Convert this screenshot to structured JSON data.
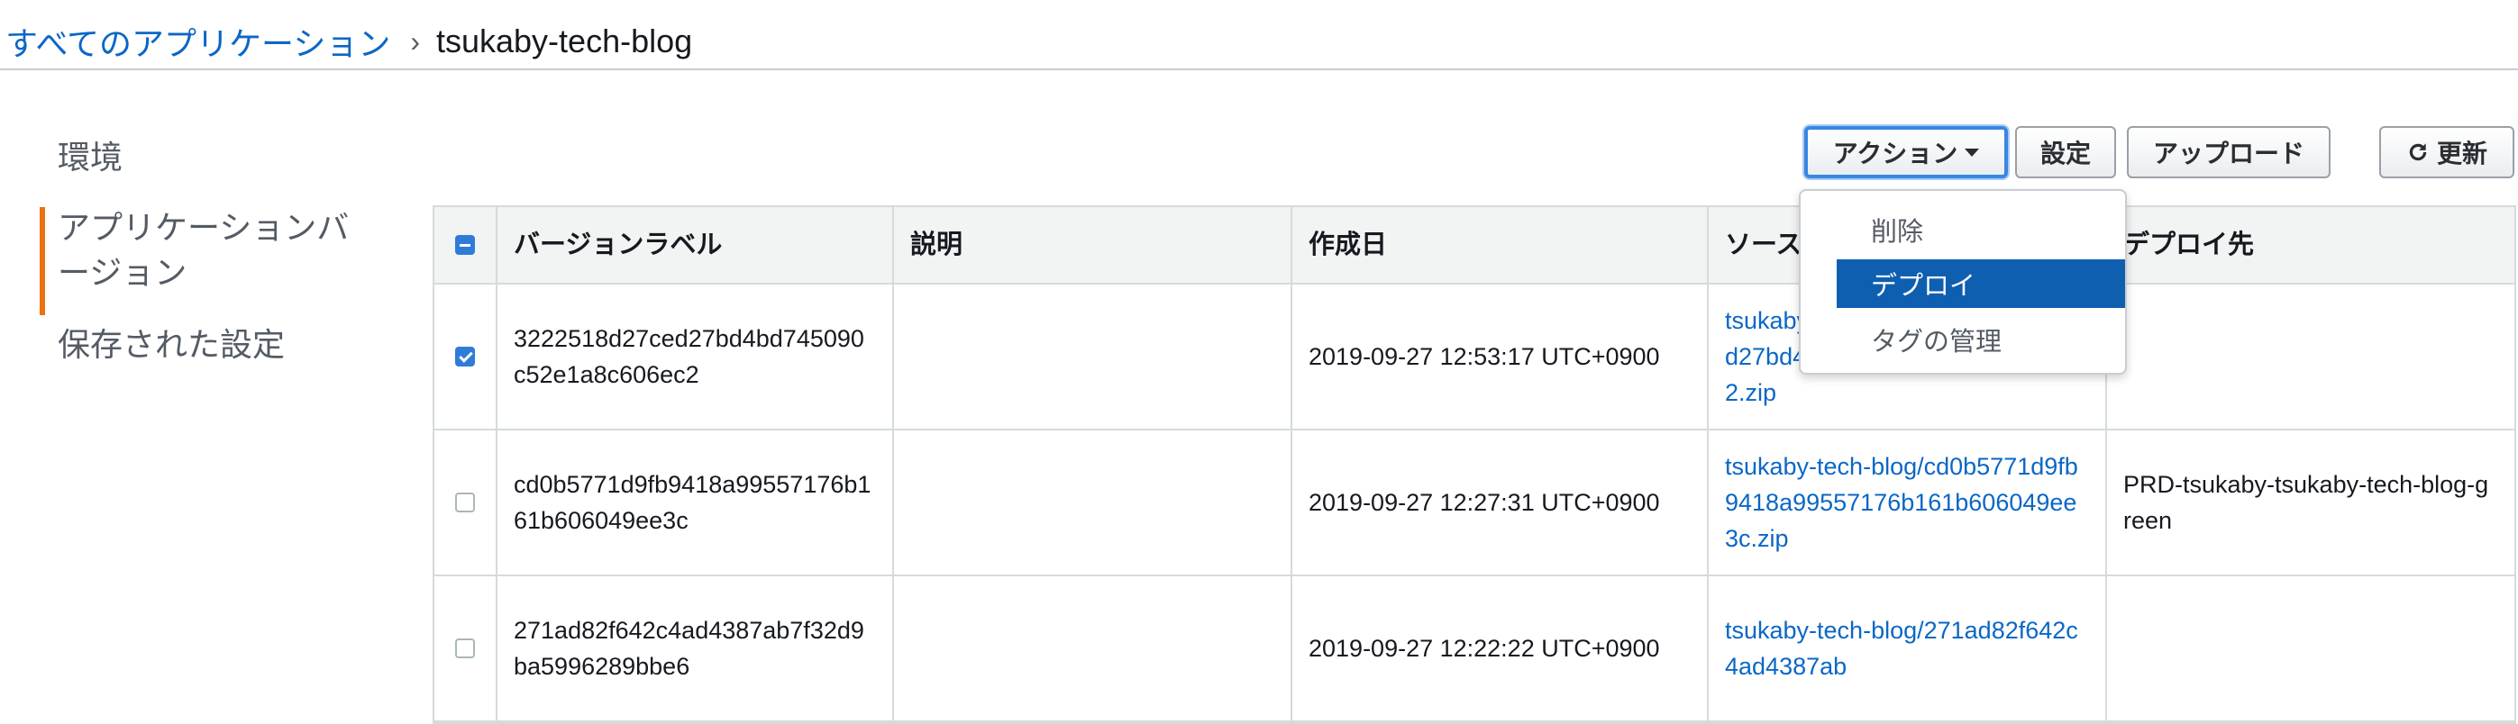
{
  "breadcrumb": {
    "root": "すべてのアプリケーション",
    "separator": "›",
    "current": "tsukaby-tech-blog"
  },
  "side_nav": {
    "items": [
      {
        "label": "環境"
      },
      {
        "label": "アプリケーションバ\nージョン",
        "active": true
      },
      {
        "label": "保存された設定"
      }
    ]
  },
  "toolbar": {
    "actions_label": "アクション",
    "settings_label": "設定",
    "upload_label": "アップロード",
    "refresh_label": "更新"
  },
  "dropdown": {
    "items": [
      "削除",
      "デプロイ",
      "タグの管理"
    ],
    "highlighted": "デプロイ"
  },
  "table": {
    "columns": [
      "バージョンラベル",
      "説明",
      "作成日",
      "ソース",
      "デプロイ先"
    ],
    "header_checkbox": "partial",
    "rows": [
      {
        "checked": true,
        "label": "3222518d27ced27bd4bd745090c52e1a8c606ec2",
        "description": "",
        "created": "2019-09-27 12:53:17 UTC+0900",
        "source": "tsukaby-tech-blog/3222518d27ced27bd4bd745090c52e1a8c606ec2.zip",
        "deployed_to": ""
      },
      {
        "checked": false,
        "label": "cd0b5771d9fb9418a99557176b161b606049ee3c",
        "description": "",
        "created": "2019-09-27 12:27:31 UTC+0900",
        "source": "tsukaby-tech-blog/cd0b5771d9fb9418a99557176b161b606049ee3c.zip",
        "deployed_to": "PRD-tsukaby-tsukaby-tech-blog-green"
      },
      {
        "checked": false,
        "label": "271ad82f642c4ad4387ab7f32d9ba5996289bbe6",
        "description": "",
        "created": "2019-09-27 12:22:22 UTC+0900",
        "source": "tsukaby-tech-blog/271ad82f642c4ad4387ab",
        "deployed_to": ""
      }
    ]
  },
  "colors": {
    "link": "#0b67c5",
    "nav_active_bar": "#ec7211",
    "menu_highlight": "#0f5fb1",
    "checkbox_on": "#2f7cd8"
  },
  "icons": {
    "refresh": "refresh-icon",
    "caret": "caret-down-icon"
  }
}
